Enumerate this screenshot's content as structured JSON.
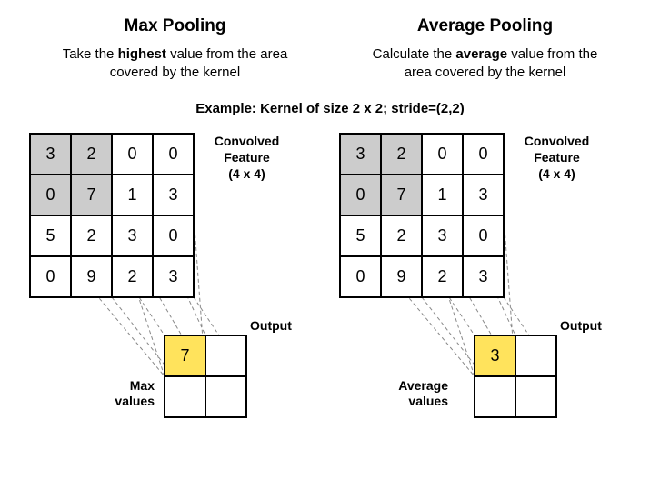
{
  "left": {
    "title": "Max Pooling",
    "desc_pre": "Take the ",
    "desc_bold": "highest",
    "desc_post": " value from the area covered by the kernel",
    "conv_label_l1": "Convolved",
    "conv_label_l2": "Feature",
    "conv_label_l3": "(4 x 4)",
    "output_label": "Output",
    "values_label_l1": "Max",
    "values_label_l2": "values",
    "grid": [
      "3",
      "2",
      "0",
      "0",
      "0",
      "7",
      "1",
      "3",
      "5",
      "2",
      "3",
      "0",
      "0",
      "9",
      "2",
      "3"
    ],
    "out": [
      "7",
      "",
      "",
      ""
    ]
  },
  "right": {
    "title": "Average Pooling",
    "desc_pre": "Calculate the ",
    "desc_bold": "average",
    "desc_post": " value from the area covered by the kernel",
    "conv_label_l1": "Convolved",
    "conv_label_l2": "Feature",
    "conv_label_l3": "(4 x 4)",
    "output_label": "Output",
    "values_label_l1": "Average",
    "values_label_l2": "values",
    "grid": [
      "3",
      "2",
      "0",
      "0",
      "0",
      "7",
      "1",
      "3",
      "5",
      "2",
      "3",
      "0",
      "0",
      "9",
      "2",
      "3"
    ],
    "out": [
      "3",
      "",
      "",
      ""
    ]
  },
  "example": {
    "lead": "Example:",
    "text": "  Kernel of size 2 x 2;  stride=(2,2)"
  }
}
